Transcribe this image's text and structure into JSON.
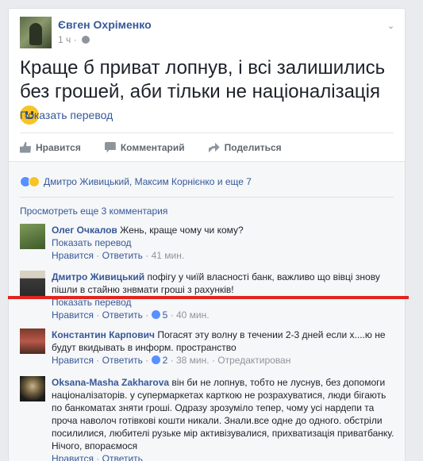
{
  "post": {
    "author": "Євген Охріменко",
    "time": "1 ч",
    "text": "Краще б приват лопнув, і всі залишились без грошей, аби тільки не націоналізація",
    "translate": "Показать перевод",
    "actions": {
      "like": "Нравится",
      "comment": "Комментарий",
      "share": "Поделиться"
    }
  },
  "reactions": {
    "text": "Дмитро Живицький, Максим Корнієнко и еще 7"
  },
  "comments_header": {
    "more": "Просмотреть еще 3 комментария"
  },
  "comments": [
    {
      "author": "Олег Очкалов",
      "text": "Жень, краще чому чи кому?",
      "translate": "Показать перевод",
      "like": "Нравится",
      "reply": "Ответить",
      "time": "41 мин."
    },
    {
      "author": "Дмитро Живицький",
      "text": "пофігу у чиїй власності банк, важливо що вівці знову пішли в стайню знвмати гроші з рахунків!",
      "translate": "Показать перевод",
      "like": "Нравится",
      "reply": "Ответить",
      "likes": "5",
      "time": "40 мин."
    },
    {
      "author": "Константин Карпович",
      "text": "Погасят эту волну в течении 2-3 дней если х....ю не будут вкидывать в информ. пространство",
      "like": "Нравится",
      "reply": "Ответить",
      "likes": "2",
      "time": "38 мин.",
      "edited": "Отредактирован"
    },
    {
      "author": "Oksana-Masha Zakharova",
      "text": "він би не лопнув, тобто не луснув, без допомоги націоналізаторів. у супермаркетах карткою не розрахуватися, люди бігають по банкоматах зняти гроші. Одразу зрозуміло тепер, чому усі нардепи та проча наволоч готівкові кошти никали. Знали.все одне до одного. обстріли посилилися, любителі рузьке мір активізувалися, прихватизація приватбанку. Нічого, впораємося",
      "like": "Нравится",
      "reply": "Ответить"
    }
  ],
  "separator": "·",
  "colors": {
    "link": "#365899",
    "annotation": "#e0261e"
  }
}
